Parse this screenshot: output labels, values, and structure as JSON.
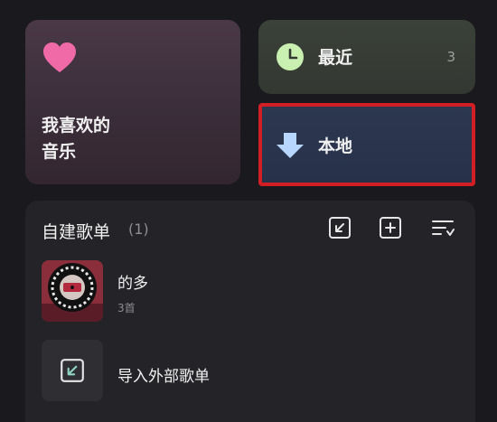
{
  "favorites": {
    "label_line1": "我喜欢的",
    "label_line2": "音乐"
  },
  "recent": {
    "label": "最近",
    "count": "3"
  },
  "local": {
    "label": "本地"
  },
  "playlists": {
    "title": "自建歌单",
    "count": "(1)",
    "items": [
      {
        "name": "的多",
        "tracks": "3首"
      }
    ],
    "import_label": "导入外部歌单"
  },
  "colors": {
    "heart": "#f06aa8",
    "clock": "#c9f0b0",
    "download": "#b7d7ff",
    "highlight": "#d21f26"
  }
}
